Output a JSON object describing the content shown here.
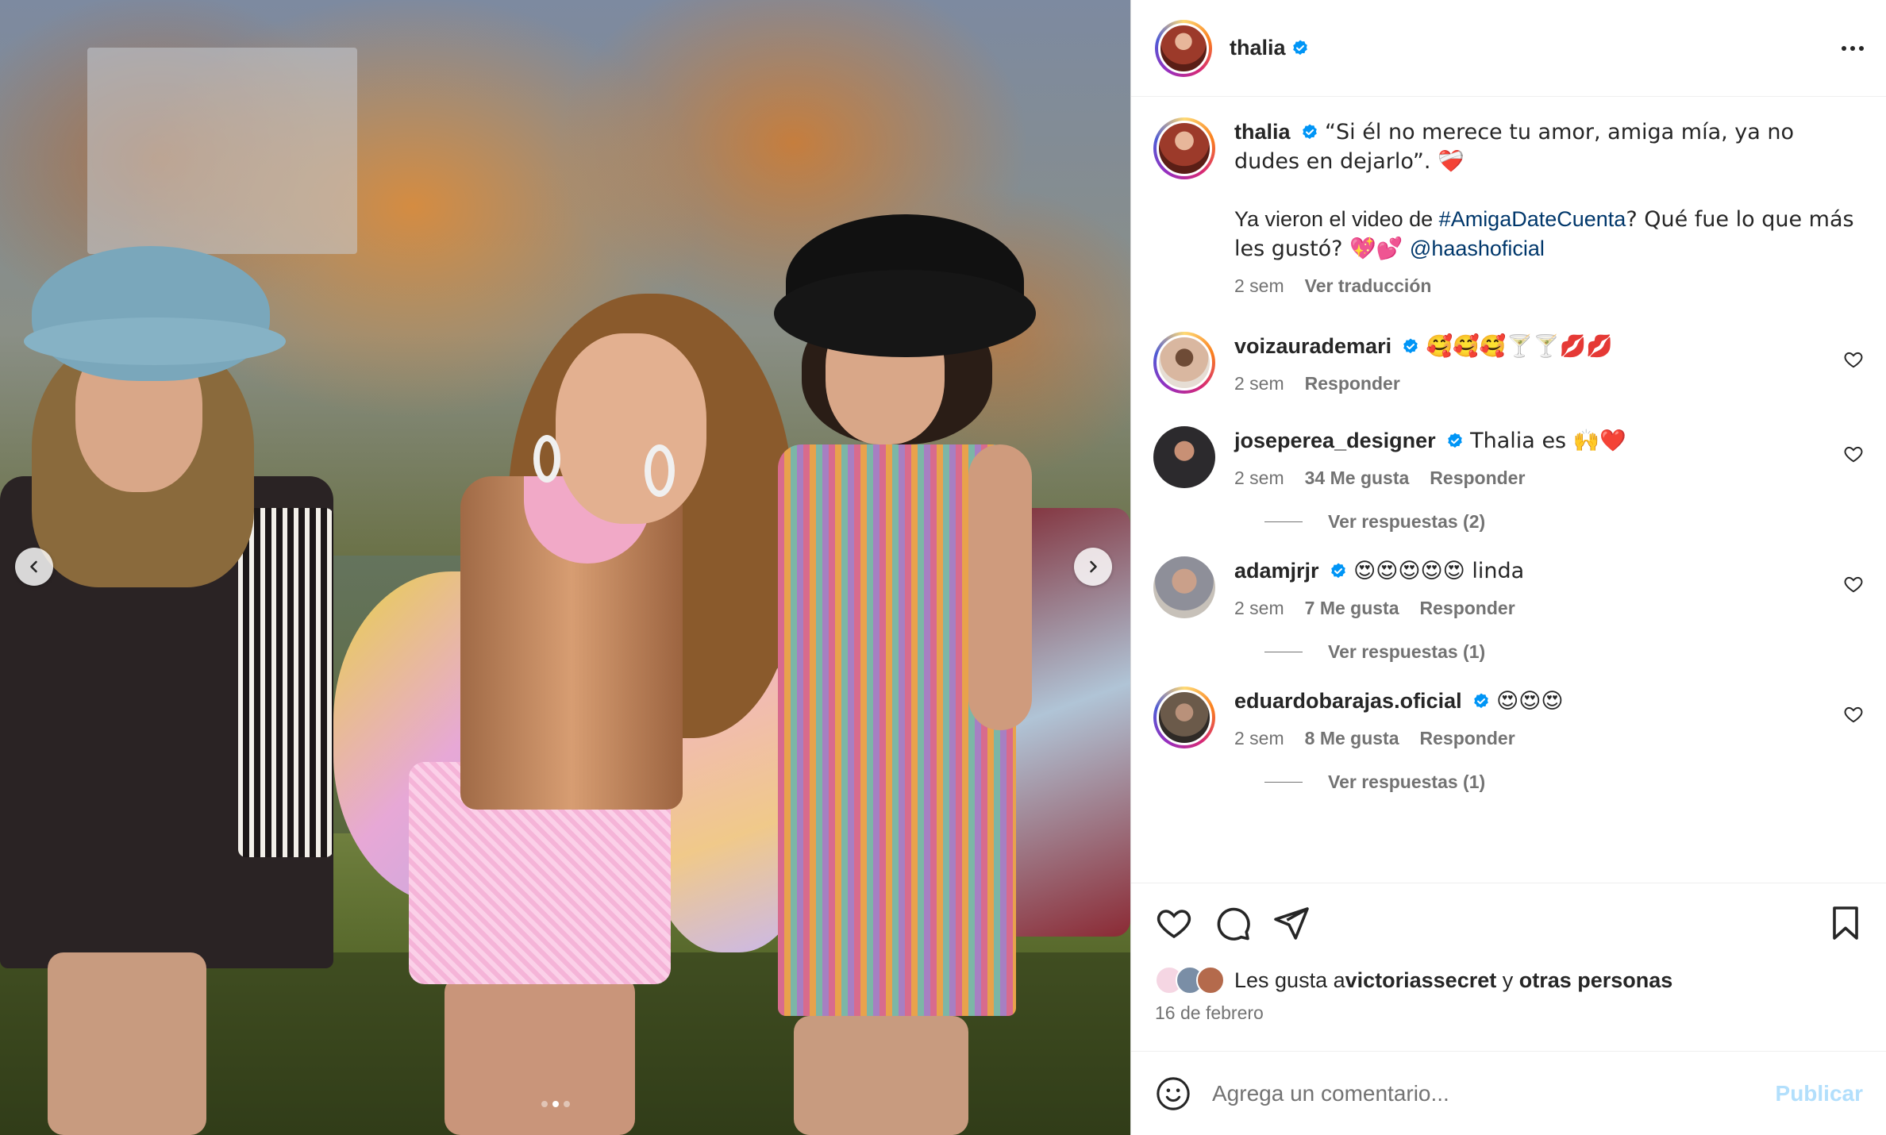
{
  "post": {
    "author": "thalia",
    "caption_line1": "“Si él no merece tu amor, amiga mía, ya no dudes en dejarlo”. ❤️‍🩹",
    "caption_line2_pre": "Ya vieron el video de ",
    "caption_hashtag": "#AmigaDateCuenta",
    "caption_line2_mid": "? Qué fue lo que más les gustó? 💖💕 ",
    "caption_mention": "@haashoficial",
    "caption_time": "2 sem",
    "translate_label": "Ver traducción"
  },
  "comments": [
    {
      "user": "voizaurademari",
      "text": "🥰🥰🥰🍸🍸💋💋",
      "time": "2 sem",
      "likes": "",
      "reply_label": "Responder",
      "view_replies": ""
    },
    {
      "user": "joseperea_designer",
      "text": "Thalia es 🙌❤️",
      "time": "2 sem",
      "likes": "34 Me gusta",
      "reply_label": "Responder",
      "view_replies": "Ver respuestas (2)"
    },
    {
      "user": "adamjrjr",
      "text": "😍😍😍😍😍 linda",
      "time": "2 sem",
      "likes": "7 Me gusta",
      "reply_label": "Responder",
      "view_replies": "Ver respuestas (1)"
    },
    {
      "user": "eduardobarajas.oficial",
      "text": "😍😍😍",
      "time": "2 sem",
      "likes": "8 Me gusta",
      "reply_label": "Responder",
      "view_replies": "Ver respuestas (1)"
    }
  ],
  "likes": {
    "prefix": "Les gusta a ",
    "user": "victoriassecret",
    "connector": " y ",
    "others": "otras personas"
  },
  "date": "16 de febrero",
  "composer": {
    "placeholder": "Agrega un comentario...",
    "publish_label": "Publicar"
  },
  "carousel": {
    "total_slides": 3,
    "active_slide": 2
  },
  "colors": {
    "verified": "#0095f6",
    "link": "#00376b",
    "muted": "#737373",
    "publish_disabled": "#b2dffc"
  },
  "icons": [
    "verified-icon",
    "more-icon",
    "heart-icon",
    "comment-icon",
    "share-icon",
    "bookmark-icon",
    "emoji-icon",
    "chevron-left-icon",
    "chevron-right-icon"
  ]
}
